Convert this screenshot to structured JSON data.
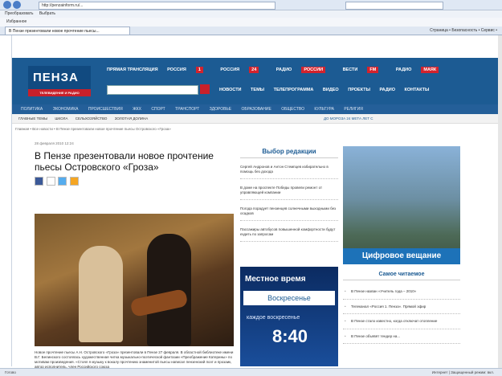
{
  "browser": {
    "address": "http://penzainform.ru/...",
    "menu": [
      "Преобразовать",
      "Выбрать"
    ],
    "favorites": "Избранное",
    "tab_title": "В Пензе презентовали новое прочтение пьесы...",
    "tools": "Страница • Безопасность • Сервис •"
  },
  "site": {
    "logo": "ПЕНЗА",
    "logo_sub": "ТЕЛЕВИДЕНИЕ И РАДИО",
    "live": "ПРЯМАЯ ТРАНСЛЯЦИЯ",
    "channels": [
      {
        "name": "РОССИЯ",
        "badge": "1"
      },
      {
        "name": "РОССИЯ",
        "badge": "24"
      },
      {
        "name": "РАДИО",
        "badge": "РОССИИ"
      },
      {
        "name": "ВЕСТИ",
        "badge": "FM"
      },
      {
        "name": "РАДИО",
        "badge": "МАЯК"
      }
    ],
    "top_menu": [
      "НОВОСТИ",
      "ТЕМЫ",
      "ТЕЛЕПРОГРАММА",
      "ВИДЕО",
      "ПРОЕКТЫ",
      "РАДИО",
      "КОНТАКТЫ"
    ],
    "categories": [
      "ПОЛИТИКА",
      "ЭКОНОМИКА",
      "ПРОИСШЕСТВИЯ",
      "ЖКХ",
      "СПОРТ",
      "ТРАНСПОРТ",
      "ЗДОРОВЬЕ",
      "ОБРАЗОВАНИЕ",
      "ОБЩЕСТВО",
      "КУЛЬТУРА",
      "РЕЛИГИЯ"
    ],
    "sub_menu": [
      "ГЛАВНЫЕ ТЕМЫ",
      "ШКОЛА",
      "СЕЛЬХОЗЯЙСТВО",
      "ЗОЛОТАЯ ДОЛИНА"
    ],
    "weather": "ДО МОРОЗА 24 МЕТА ЛЕТ С",
    "breadcrumb": "Главная • Все новости • В Пензе презентовали новое прочтение пьесы Островского «Гроза»"
  },
  "article": {
    "date": "28 февраля 2010 12:24",
    "title": "В Пензе презентовали новое прочтение пьесы Островского «Гроза»",
    "caption": "Новое прочтение пьесы А.Н. Островского «Гроза» презентовали в Пензе 27 февраля. В областной библиотеке имени В.Г. Белинского состоялась художественная читка музыкально-поэтической фантазии «Преображение Катерины» по мотивам произведения. «Стоял я музыку к вокалу прочтению знаменитой пьесы написал пензенский поэт и прозаик, автор исполнитель, член Российского союза"
  },
  "editors": {
    "title": "Выбор редакции",
    "items": [
      "Сергей Андронов и Антон Стемпцев избирательно в помощь без дохода",
      "В доме на проспекте Победы провели ремонт от управляющей компании",
      "Погода порадует пензенцев солнечными выходными без осадков",
      "Пассажиры автобусов повышенной комфортности будут ездить по запросам"
    ]
  },
  "promo": {
    "line1": "Местное время",
    "line2": "Воскресенье",
    "line3": "каждое воскресенье",
    "time": "8:40"
  },
  "sidebar": {
    "banner": "Цифровое вещание",
    "most_read_title": "Самое читаемое",
    "most_read": [
      "В Пензе назван «Учитель года – 2010»",
      "Телеканал «Россия 1. Пенза». Прямой эфир",
      "В Пензе стало известно, когда отключат отопление",
      "В Пензе объявят тендер на..."
    ]
  },
  "status": {
    "left": "Готово",
    "right": "Интернет | Защищенный режим: вкл."
  }
}
